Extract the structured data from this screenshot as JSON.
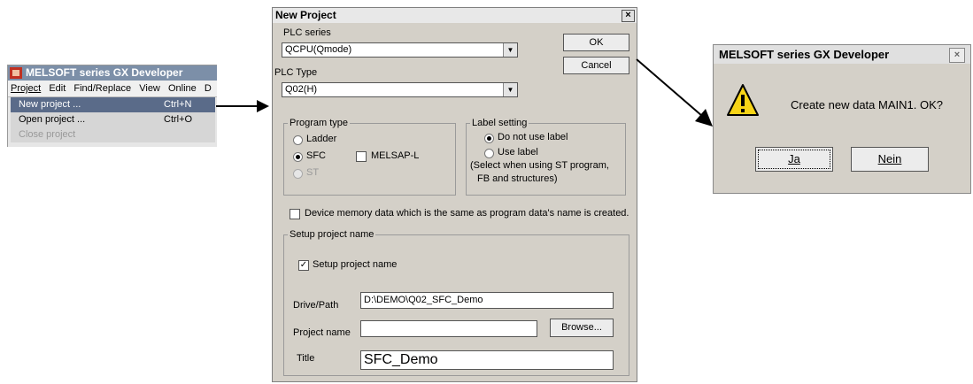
{
  "menu_window": {
    "title": "MELSOFT series GX Developer",
    "menubar": [
      "Project",
      "Edit",
      "Find/Replace",
      "View",
      "Online",
      "D"
    ],
    "items": [
      {
        "label": "New project ...",
        "shortcut": "Ctrl+N"
      },
      {
        "label": "Open project ...",
        "shortcut": "Ctrl+O"
      },
      {
        "label": "Close project",
        "shortcut": ""
      }
    ]
  },
  "new_project": {
    "title": "New Project",
    "plc_series_label": "PLC series",
    "plc_series_value": "QCPU(Qmode)",
    "plc_type_label": "PLC Type",
    "plc_type_value": "Q02(H)",
    "ok_label": "OK",
    "cancel_label": "Cancel",
    "program_type": {
      "label": "Program type",
      "ladder": "Ladder",
      "sfc": "SFC",
      "melsap": "MELSAP-L",
      "st": "ST"
    },
    "label_setting": {
      "label": "Label setting",
      "no_label": "Do not use label",
      "use_label": "Use label",
      "note_line1": "(Select when using ST program,",
      "note_line2": "FB and structures)"
    },
    "device_memory_text": "Device memory data which is the same as program data's name is created.",
    "setup": {
      "group_label": "Setup project name",
      "checkbox_label": "Setup project name",
      "drive_path_label": "Drive/Path",
      "drive_path_value": "D:\\DEMO\\Q02_SFC_Demo",
      "project_name_label": "Project name",
      "project_name_value": "",
      "browse_label": "Browse...",
      "title_label": "Title",
      "title_value": "SFC_Demo"
    }
  },
  "message_box": {
    "title": "MELSOFT series GX Developer",
    "text": "Create new data MAIN1. OK?",
    "yes_label": "Ja",
    "no_label": "Nein"
  }
}
